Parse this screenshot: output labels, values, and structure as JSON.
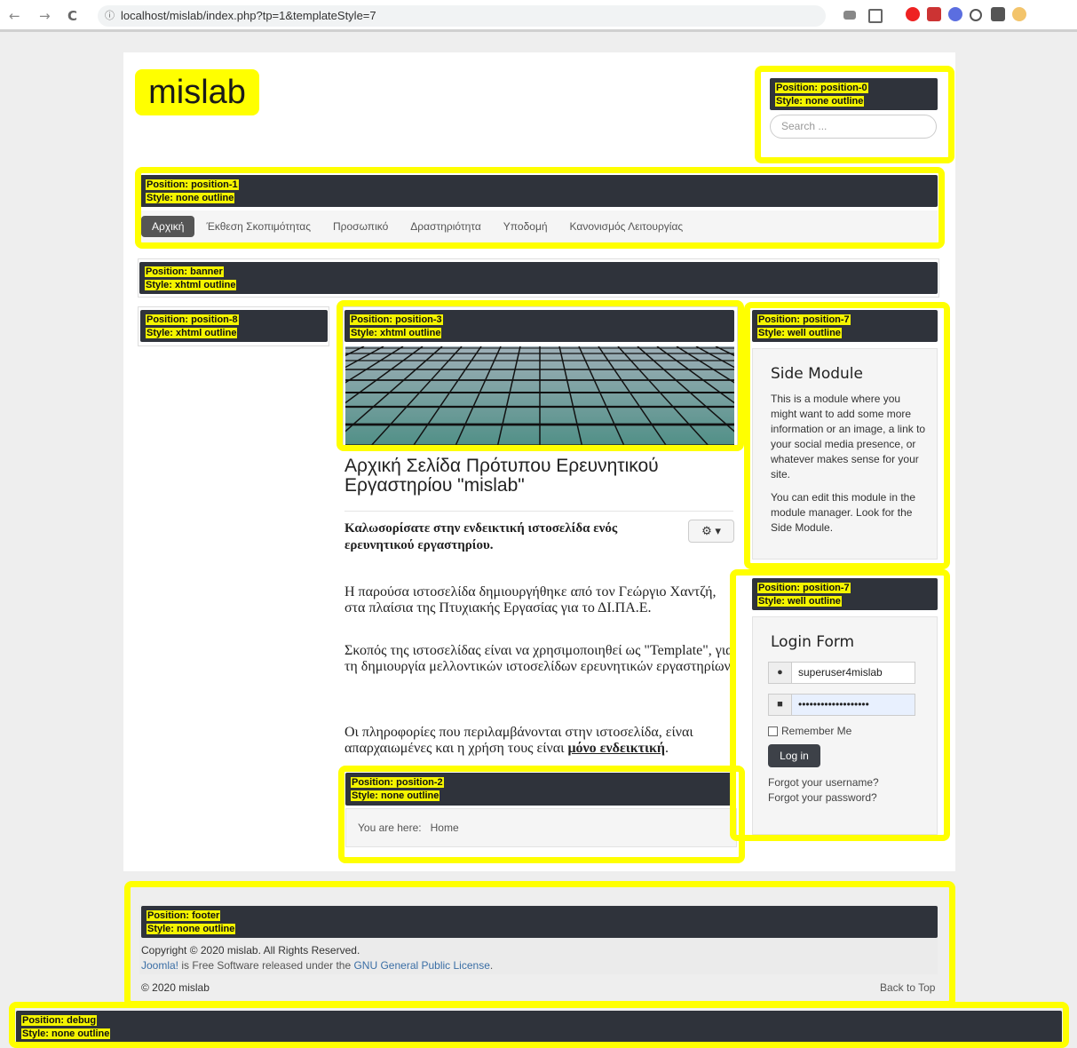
{
  "browser": {
    "back_glyph": "←",
    "forward_glyph": "→",
    "reload_glyph": "C",
    "url": "localhost/mislab/index.php?tp=1&templateStyle=7",
    "info_glyph": "ⓘ"
  },
  "site": {
    "logo": "mislab",
    "search_placeholder": "Search ..."
  },
  "positions": {
    "p0": {
      "position": "Position: position-0",
      "style": "Style: none outline"
    },
    "p1": {
      "position": "Position: position-1",
      "style": "Style: none outline"
    },
    "banner": {
      "position": "Position: banner",
      "style": "Style: xhtml outline"
    },
    "p8": {
      "position": "Position: position-8",
      "style": "Style: xhtml outline"
    },
    "p3": {
      "position": "Position: position-3",
      "style": "Style: xhtml outline"
    },
    "p7a": {
      "position": "Position: position-7",
      "style": "Style: well outline"
    },
    "p7b": {
      "position": "Position: position-7",
      "style": "Style: well outline"
    },
    "p2": {
      "position": "Position: position-2",
      "style": "Style: none outline"
    },
    "footer": {
      "position": "Position: footer",
      "style": "Style: none outline"
    },
    "debug": {
      "position": "Position: debug",
      "style": "Style: none outline"
    }
  },
  "menu": {
    "items": [
      "Αρχική",
      "Έκθεση Σκοπιμότητας",
      "Προσωπικό",
      "Δραστηριότητα",
      "Υποδομή",
      "Κανονισμός Λειτουργίας"
    ],
    "active_index": 0
  },
  "article": {
    "title": "Αρχική Σελίδα Πρότυπου Ερευνητικού Εργαστηρίου \"mislab\"",
    "lead": "Καλωσορίσατε στην ενδεικτική ιστοσελίδα ενός ερευνητικού εργαστηρίου.",
    "gear_label": "⚙ ▾",
    "p1": "Η παρούσα ιστοσελίδα δημιουργήθηκε από τον Γεώργιο Χαντζή, στα πλαίσια της Πτυχιακής Εργασίας για το ΔΙ.ΠΑ.Ε.",
    "p2": "Σκοπός της ιστοσελίδας είναι να χρησιμοποιηθεί ως \"Template\", για τη δημιουργία μελλοντικών ιστοσελίδων ερευνητικών εργαστηρίων.",
    "p3_start": "Οι πληροφορίες που περιλαμβάνονται στην ιστοσελίδα, είναι απαρχαιωμένες και η χρήση τους είναι ",
    "p3_bold": "μόνο ενδεικτική",
    "p3_end": "."
  },
  "breadcrumb": {
    "prefix": "You are here:",
    "home": "Home"
  },
  "side_module": {
    "title": "Side Module",
    "p1": "This is a module where you might want to add some more information or an image, a link to your social media presence, or whatever makes sense for your site.",
    "p2": "You can edit this module in the module manager. Look for the Side Module."
  },
  "login": {
    "title": "Login Form",
    "username": "superuser4mislab",
    "password": "•••••••••••••••••••",
    "remember": "Remember Me",
    "button": "Log in",
    "forgot_username": "Forgot your username?",
    "forgot_password": "Forgot your password?"
  },
  "footer": {
    "copyright": "Copyright © 2020 mislab. All Rights Reserved.",
    "joomla_start": "Joomla!",
    "joomla_mid": " is Free Software released under the ",
    "gnu": "GNU General Public License",
    "joomla_end": ".",
    "small_copyright": "© 2020 mislab",
    "back_to_top": "Back to Top"
  },
  "colors": {
    "highlight": "#ffff00",
    "position_bar": "#2f333b",
    "active_menu": "#555555"
  }
}
